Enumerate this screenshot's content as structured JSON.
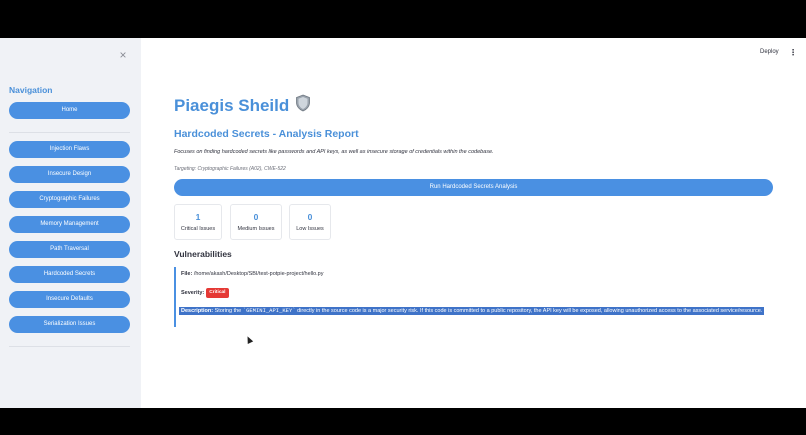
{
  "sidebar": {
    "heading": "Navigation",
    "close_glyph": "×",
    "items": [
      {
        "label": "Home"
      },
      {
        "label": "Injection Flaws"
      },
      {
        "label": "Insecure Design"
      },
      {
        "label": "Cryptographic Failures"
      },
      {
        "label": "Memory Management"
      },
      {
        "label": "Path Traversal"
      },
      {
        "label": "Hardcoded Secrets"
      },
      {
        "label": "Insecure Defaults"
      },
      {
        "label": "Serialization Issues"
      }
    ]
  },
  "topbar": {
    "deploy_label": "Deploy",
    "menu_glyph": "⋮"
  },
  "main": {
    "title": "Piaegis Sheild",
    "title_icon": "shield-icon",
    "subtitle": "Hardcoded Secrets - Analysis Report",
    "description": "Focuses on finding hardcoded secrets like passwords and API keys, as well as insecure storage of credentials within the codebase.",
    "targeting": "Targeting: Cryptographic Failures (A02), CWE-522",
    "run_button": "Run Hardcoded Secrets Analysis",
    "metrics": [
      {
        "value": "1",
        "label": "Critical Issues"
      },
      {
        "value": "0",
        "label": "Medium Issues"
      },
      {
        "value": "0",
        "label": "Low Issues"
      }
    ],
    "vulnerabilities_heading": "Vulnerabilities",
    "vulnerability": {
      "file_label": "File:",
      "file_path": "/home/akash/Desktop/SBI/test-potpie-project/hello.py",
      "severity_label": "Severity:",
      "severity_value": "Critical",
      "description_label": "Description:",
      "description_before": "Storing the ",
      "description_code": "`GEMINI_API_KEY`",
      "description_after": " directly in the source code is a major security risk. If this code is committed to a public repository, the API key will be exposed, allowing unauthorized access to the associated service/resource."
    }
  },
  "colors": {
    "accent": "#4a90e2",
    "heading_blue": "#4a90d9",
    "critical": "#e53935",
    "sidebar_bg": "#f0f2f6",
    "selection": "#3f73c8"
  }
}
